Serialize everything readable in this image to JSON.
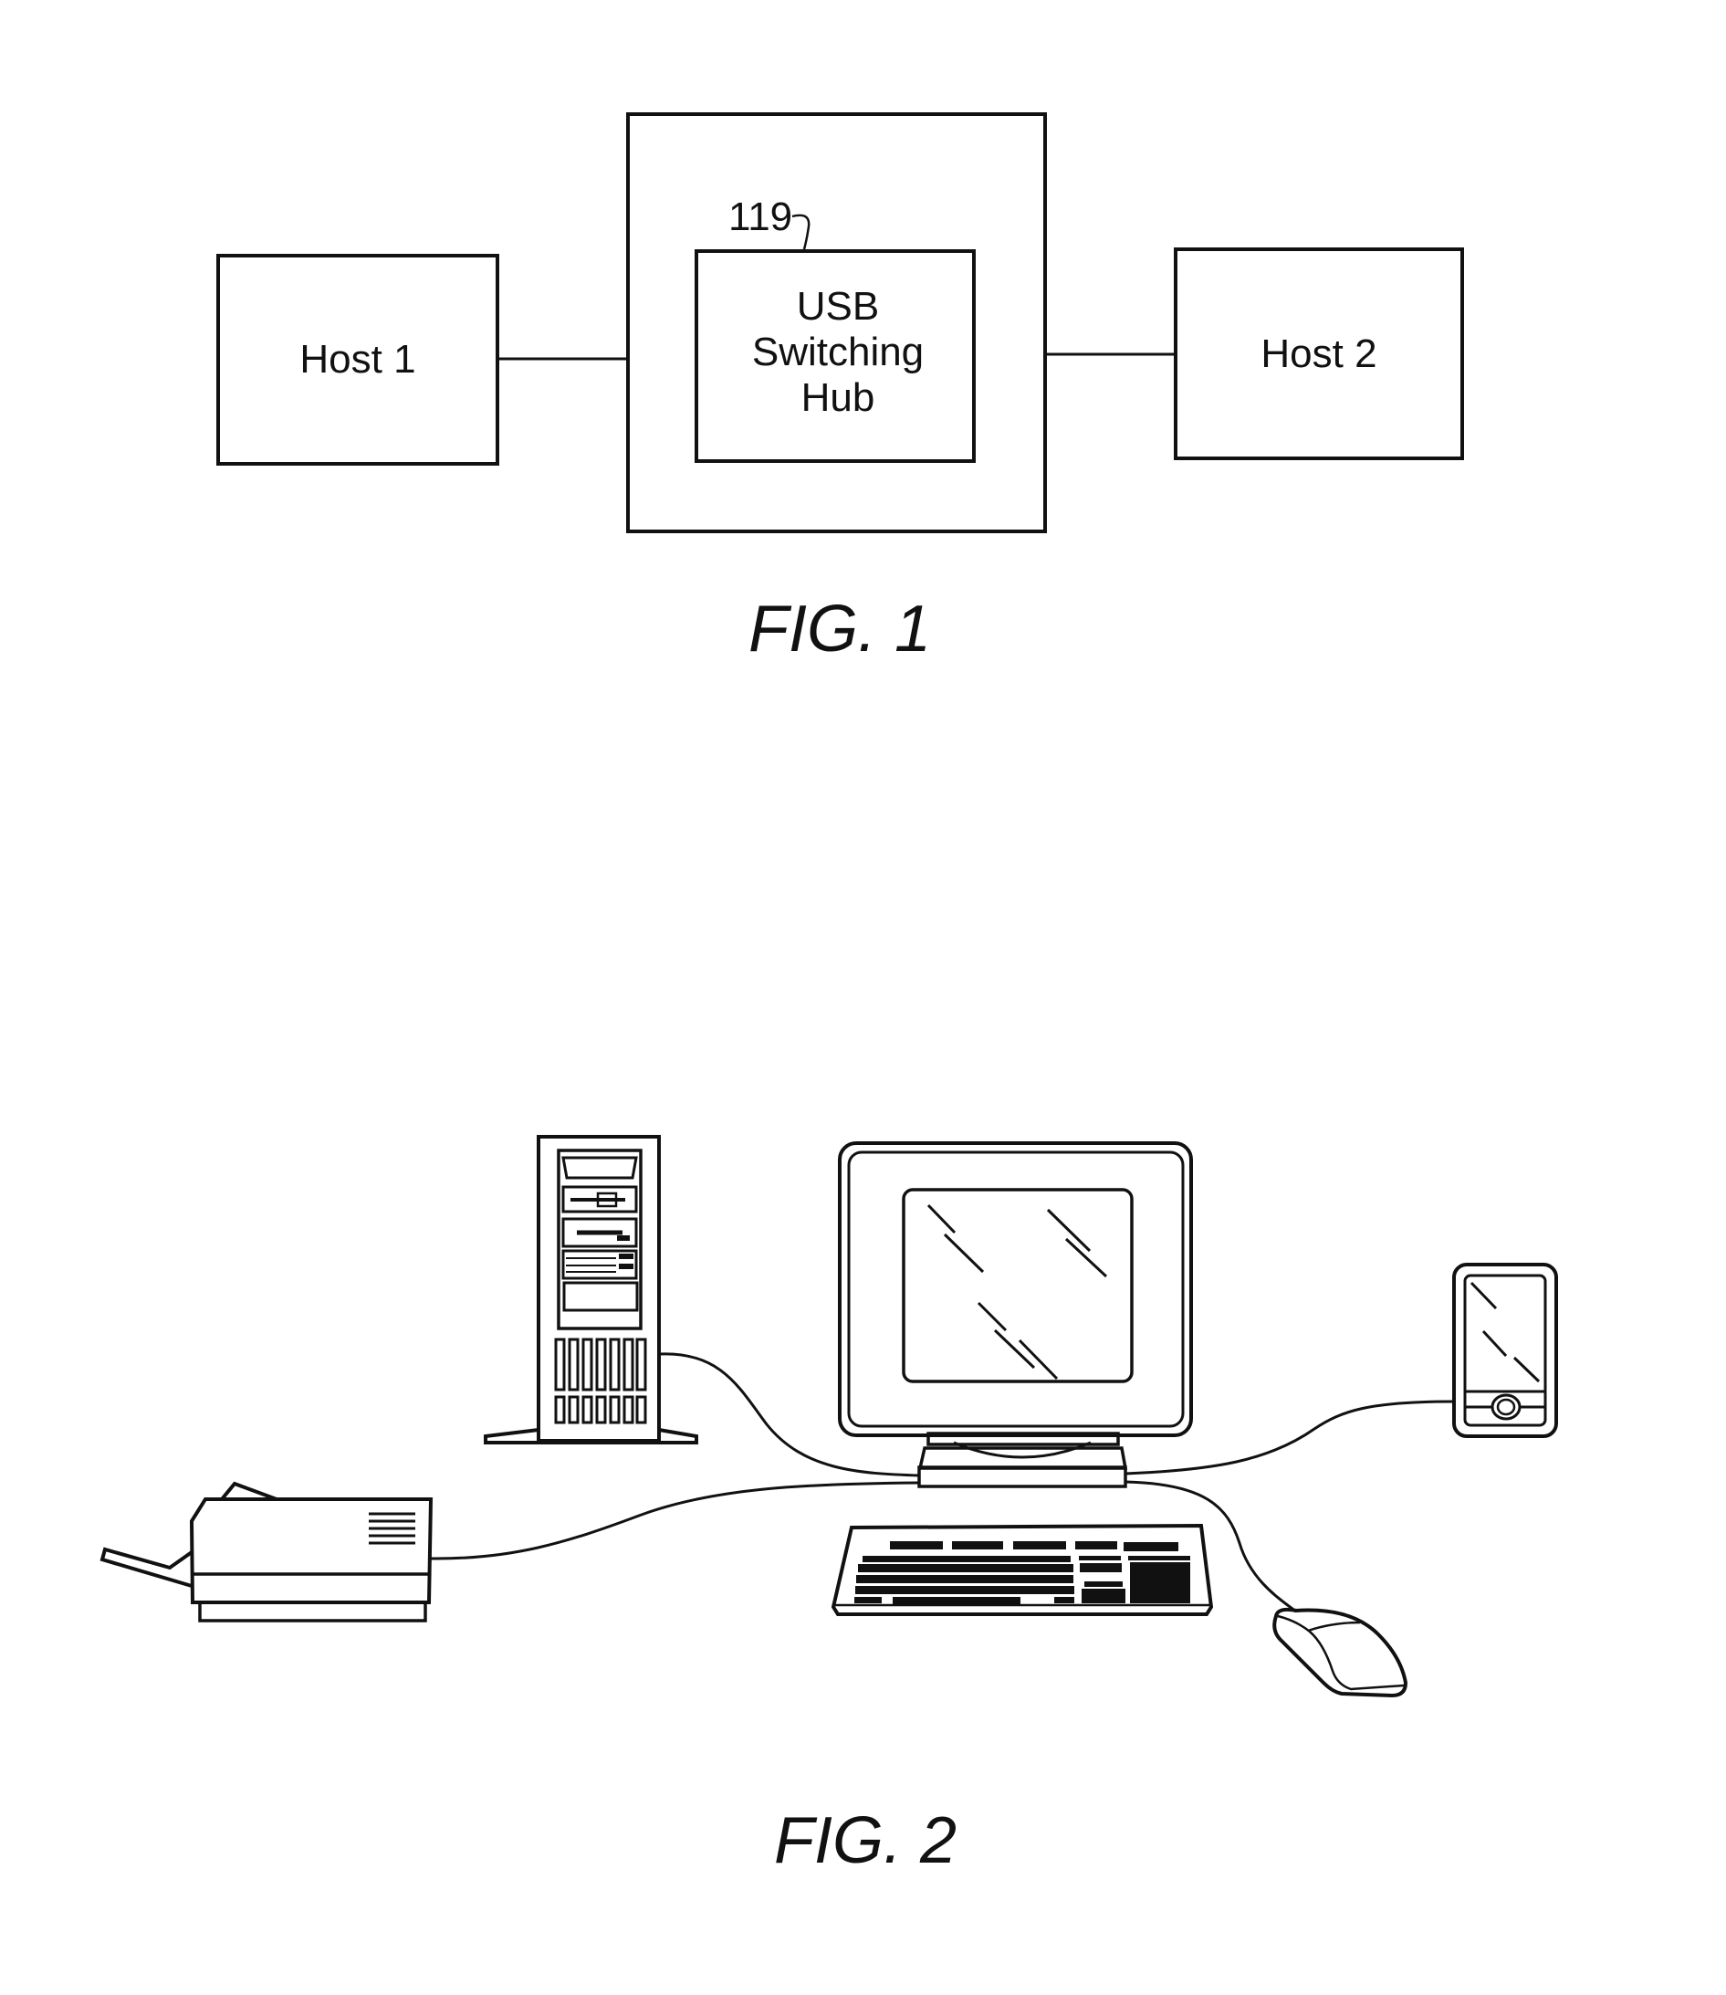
{
  "figures": [
    {
      "caption": "FIG. 1",
      "blocks": {
        "host1": "Host 1",
        "hub_line1": "USB",
        "hub_line2": "Switching",
        "hub_line3": "Hub",
        "hub_ref": "119",
        "host2": "Host 2"
      },
      "connections": [
        {
          "from": "Host 1",
          "to": "USB Switching Hub enclosure"
        },
        {
          "from": "USB Switching Hub enclosure",
          "to": "Host 2"
        }
      ]
    },
    {
      "caption": "FIG. 2",
      "devices": [
        "tower-computer",
        "monitor",
        "keyboard",
        "mouse",
        "printer",
        "handheld-device"
      ],
      "connections": [
        {
          "from": "tower-computer",
          "to": "monitor"
        },
        {
          "from": "printer",
          "to": "monitor"
        },
        {
          "from": "handheld-device",
          "to": "monitor"
        },
        {
          "from": "mouse",
          "to": "monitor"
        }
      ]
    }
  ]
}
